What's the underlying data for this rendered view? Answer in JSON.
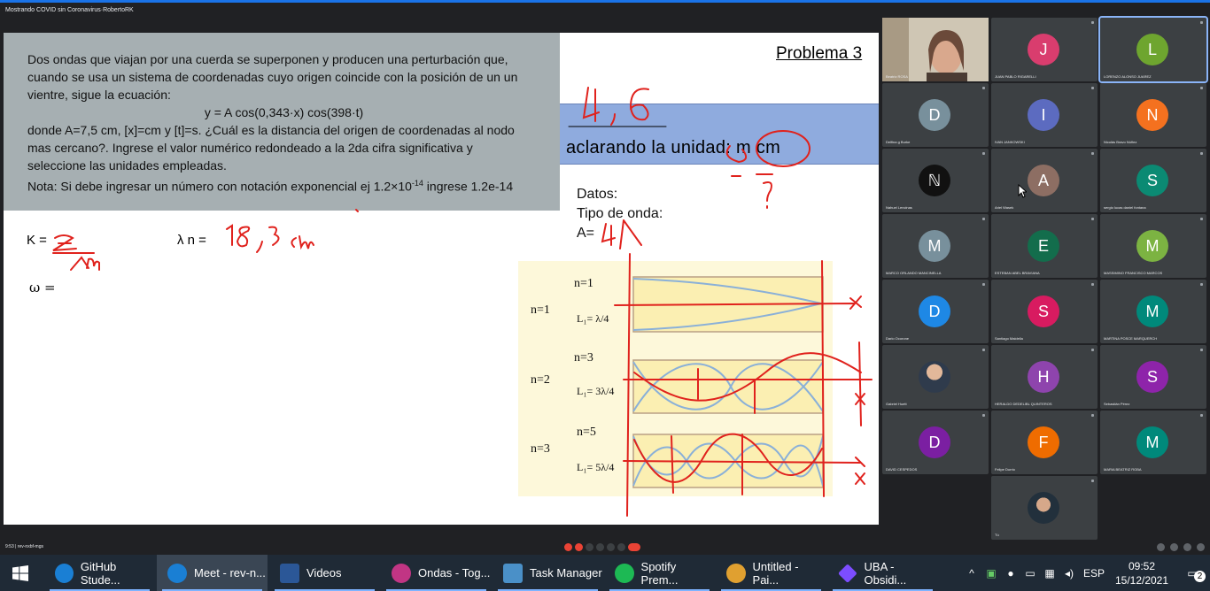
{
  "window": {
    "meet_title": "Mostrando COVID sin Coronavirus·RobertoRK"
  },
  "slide": {
    "problem_lines": [
      "Dos ondas que viajan por una cuerda se superponen y producen una  perturbación que,",
      "cuando se usa un sistema de coordenadas cuyo origen coincide con la posición de un un",
      "vientre, sigue la ecuación:"
    ],
    "equation": "y = A cos(0,343·x) cos(398·t)",
    "problem_lines2": [
      "donde A=7,5 cm, [x]=cm y [t]=s. ¿Cuál es la distancia del origen de coordenadas al nodo",
      "mas cercano?. Ingrese el valor numérico redondeado a la 2da cifra significativa y",
      "seleccione las unidades empleadas."
    ],
    "note_prefix": "Nota: Si debe ingresar un número con notación exponencial ej 1.2×10",
    "note_exp": "-14",
    "note_suffix": " ingrese 1.2e-14",
    "title": "Problema 3",
    "band_text": "aclarando la unidad: m  cm",
    "datos": [
      "Datos:",
      "Tipo de onda:",
      "A="
    ],
    "k_label": "K =",
    "ln_label": "λ n =",
    "w_label": "ω =",
    "diagram": {
      "rows": [
        {
          "n": "n=1",
          "mode": "n=1",
          "formula": "L₁= λ/4"
        },
        {
          "n": "n=2",
          "mode": "n=3",
          "formula": "L₁= 3λ/4"
        },
        {
          "n": "n=3",
          "mode": "n=5",
          "formula": "L₁= 5λ/4"
        }
      ]
    },
    "handwriting": {
      "top": "4,6",
      "k": "2π / λm",
      "ln": "18,3 cm",
      "q": "?",
      "a": "4"
    }
  },
  "participants": [
    {
      "initial": "",
      "name": "Beatriz ROSA",
      "color": "",
      "camera": true
    },
    {
      "initial": "J",
      "name": "JUAN PABLO RIGARELLI",
      "color": "#d93d6e"
    },
    {
      "initial": "L",
      "name": "LORENZO ALONSO JUAREZ",
      "color": "#6ea52f",
      "active": true
    },
    {
      "initial": "D",
      "name": "Delfina g Burke",
      "color": "#78909c"
    },
    {
      "initial": "I",
      "name": "IVAN JANKOWSKI",
      "color": "#5c6bc0"
    },
    {
      "initial": "N",
      "name": "Nicolás Bravo Núñez",
      "color": "#f4711f"
    },
    {
      "initial": "ℕ",
      "name": "Nahuel Lencinas",
      "color": "#111111"
    },
    {
      "initial": "A",
      "name": "Ariel Wasek",
      "color": "#8d6e63"
    },
    {
      "initial": "S",
      "name": "sergio lucas daniel fontana",
      "color": "#0b8a73"
    },
    {
      "initial": "M",
      "name": "MARCO ORLANDO MANCINELLA",
      "color": "#78909c"
    },
    {
      "initial": "E",
      "name": "ESTEBAN ABEL BRAVIANA",
      "color": "#136d4c"
    },
    {
      "initial": "M",
      "name": "MASSIMINO FRANCISCO MARCOS",
      "color": "#7cb342"
    },
    {
      "initial": "D",
      "name": "Dario Ocorone",
      "color": "#1e88e5"
    },
    {
      "initial": "S",
      "name": "Santiago Maidella",
      "color": "#d81b60"
    },
    {
      "initial": "M",
      "name": "MARTINA POSCE MARQUERCH",
      "color": "#00897b"
    },
    {
      "initial": "",
      "name": "Gabriel Huett",
      "color": "#5d8aa8",
      "photo": true
    },
    {
      "initial": "H",
      "name": "HERALDO DEDELIBL QUINTEROS",
      "color": "#8e44ad"
    },
    {
      "initial": "S",
      "name": "Sebastián Pérez",
      "color": "#8e24aa"
    },
    {
      "initial": "D",
      "name": "DAVID CESPEDOS",
      "color": "#7b1fa2"
    },
    {
      "initial": "F",
      "name": "Felipe Durrio",
      "color": "#ef6c00"
    },
    {
      "initial": "M",
      "name": "MARIA BEATRIZ ROBA",
      "color": "#00897b"
    },
    {
      "initial": "",
      "name": "Tú",
      "color": "#1565c0",
      "photo": true
    }
  ],
  "meet_bar": {
    "time_label": "9:53  |  rev-nxbf-mgs"
  },
  "taskbar": {
    "items": [
      {
        "label": "GitHub Stude...",
        "color": "#1a7fd4"
      },
      {
        "label": "Meet - rev-n...",
        "color": "#1a7fd4",
        "active": true
      },
      {
        "label": "Videos",
        "color": "#2b5797"
      },
      {
        "label": "Ondas - Tog...",
        "color": "#c13584"
      },
      {
        "label": "Task Manager",
        "color": "#4a90c8"
      },
      {
        "label": "Spotify Prem...",
        "color": "#1db954"
      },
      {
        "label": "Untitled - Pai...",
        "color": "#e0a030"
      },
      {
        "label": "UBA - Obsidi...",
        "color": "#7c4dff"
      }
    ],
    "lang": "ESP",
    "time": "09:52",
    "date": "15/12/2021",
    "notif": "2"
  }
}
